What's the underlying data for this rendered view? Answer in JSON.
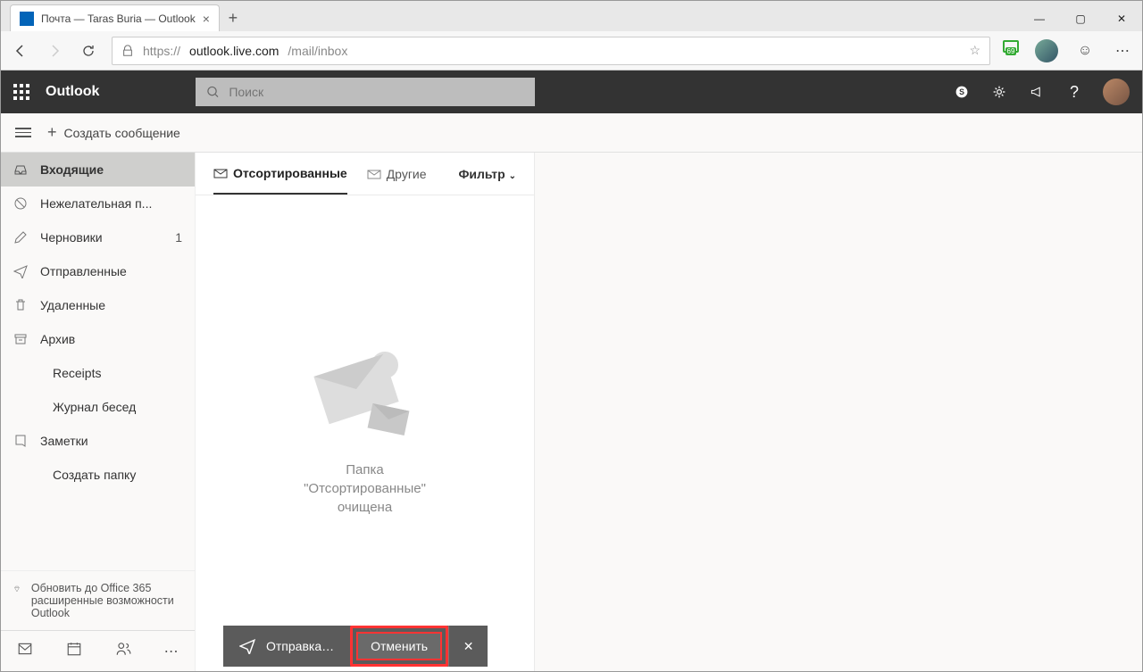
{
  "browser": {
    "tab_title": "Почта — Taras Buria — Outlook",
    "url_prefix": "https://",
    "url_host": "outlook.live.com",
    "url_path": "/mail/inbox",
    "ext_badge": "69"
  },
  "header": {
    "brand": "Outlook",
    "search_placeholder": "Поиск"
  },
  "cmd": {
    "new_message": "Создать сообщение"
  },
  "sidebar": {
    "folders": [
      {
        "label": "Входящие",
        "count": ""
      },
      {
        "label": "Нежелательная п...",
        "count": ""
      },
      {
        "label": "Черновики",
        "count": "1"
      },
      {
        "label": "Отправленные",
        "count": ""
      },
      {
        "label": "Удаленные",
        "count": ""
      },
      {
        "label": "Архив",
        "count": ""
      },
      {
        "label": "Receipts",
        "count": ""
      },
      {
        "label": "Журнал бесед",
        "count": ""
      },
      {
        "label": "Заметки",
        "count": ""
      },
      {
        "label": "Создать папку",
        "count": ""
      }
    ],
    "upgrade": "Обновить до Office 365 расширенные возможности Outlook"
  },
  "list": {
    "tab_focused": "Отсортированные",
    "tab_other": "Другие",
    "filter": "Фильтр",
    "empty_l1": "Папка",
    "empty_l2": "\"Отсортированные\"",
    "empty_l3": "очищена"
  },
  "toast": {
    "sending": "Отправка…",
    "cancel": "Отменить"
  }
}
